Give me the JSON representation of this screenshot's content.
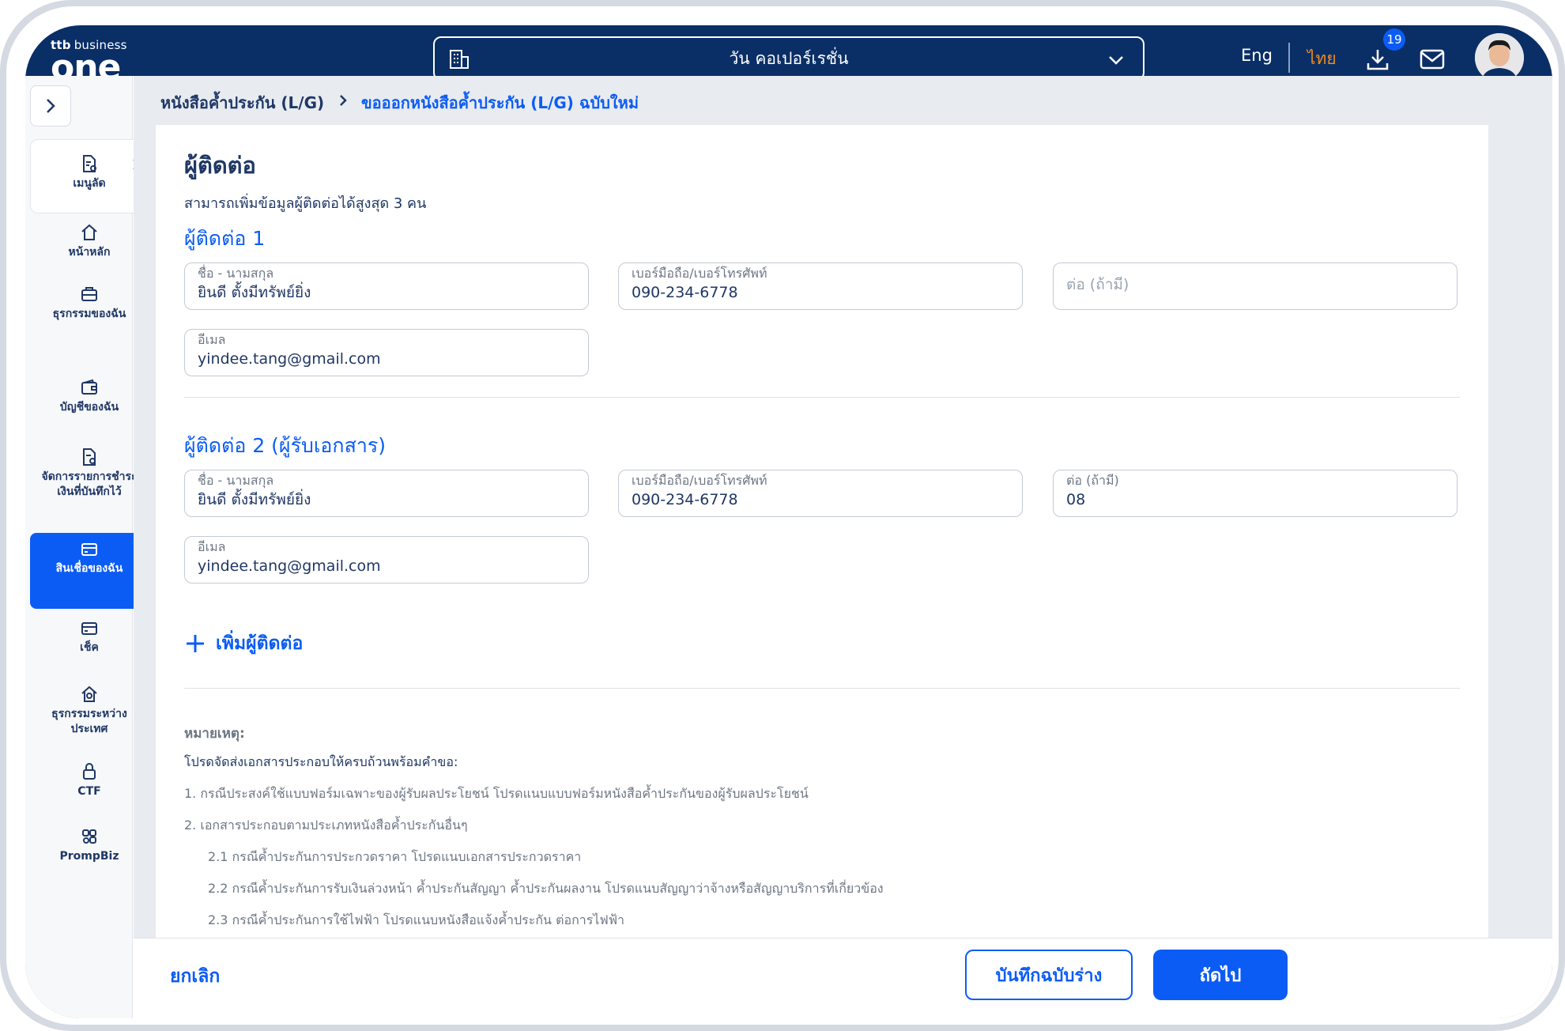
{
  "header": {
    "logo_top_brand": "ttb",
    "logo_top_text": "business",
    "logo_main": "one",
    "company_name": "วัน คอเปอร์เรชั่น",
    "lang_en": "Eng",
    "lang_th": "ไทย",
    "download_badge": "19"
  },
  "sidebar": {
    "items": [
      {
        "label": "เมนูลัด",
        "icon": "doc-shortcut-icon"
      },
      {
        "label": "หน้าหลัก",
        "icon": "home-icon"
      },
      {
        "label": "ธุรกรรมของฉัน",
        "icon": "briefcase-icon"
      },
      {
        "label": "บัญชีของฉัน",
        "icon": "wallet-icon"
      },
      {
        "label": "จัดการรายการชำระเงินที่บันทึกไว้",
        "icon": "doc-settings-icon"
      },
      {
        "label": "สินเชื่อของฉัน",
        "icon": "credit-card-icon"
      },
      {
        "label": "เช็ค",
        "icon": "cheque-icon"
      },
      {
        "label": "ธุรกรรมระหว่างประเทศ",
        "icon": "international-icon"
      },
      {
        "label": "CTF",
        "icon": "lock-icon"
      },
      {
        "label": "PrompBiz",
        "icon": "prompbiz-icon"
      }
    ]
  },
  "breadcrumb": {
    "parent": "หนังสือค้ำประกัน (L/G)",
    "current": "ขอออกหนังสือค้ำประกัน (L/G) ฉบับใหม่"
  },
  "section": {
    "title": "ผู้ติดต่อ",
    "subtitle": "สามารถเพิ่มข้อมูลผู้ติดต่อได้สูงสุด 3 คน"
  },
  "contact1": {
    "title": "ผู้ติดต่อ 1",
    "name_label": "ชื่อ - นามสกุล",
    "name_value": "ยินดี ตั้งมีทรัพย์ยิ่ง",
    "phone_label": "เบอร์มือถือ/เบอร์โทรศัพท์",
    "phone_value": "090-234-6778",
    "ext_placeholder": "ต่อ (ถ้ามี)",
    "email_label": "อีเมล",
    "email_value": "yindee.tang@gmail.com"
  },
  "contact2": {
    "title": "ผู้ติดต่อ 2 (ผู้รับเอกสาร)",
    "name_label": "ชื่อ - นามสกุล",
    "name_value": "ยินดี ตั้งมีทรัพย์ยิ่ง",
    "phone_label": "เบอร์มือถือ/เบอร์โทรศัพท์",
    "phone_value": "090-234-6778",
    "ext_label": "ต่อ (ถ้ามี)",
    "ext_value": "08",
    "email_label": "อีเมล",
    "email_value": "yindee.tang@gmail.com"
  },
  "add_contact_label": "เพิ่มผู้ติดต่อ",
  "notes": {
    "title": "หมายเหตุ:",
    "intro": "โปรดจัดส่งเอกสารประกอบให้ครบถ้วนพร้อมคำขอ:",
    "items": [
      "1.   กรณีประสงค์ใช้แบบฟอร์มเฉพาะของผู้รับผลประโยชน์ โปรดแนบแบบฟอร์มหนังสือค้ำประกันของผู้รับผลประโยชน์",
      "2.   เอกสารประกอบตามประเภทหนังสือค้ำประกันอื่นๆ",
      "2.1  กรณีค้ำประกันการประกวดราคา โปรดแนบเอกสารประกวดราคา",
      "2.2  กรณีค้ำประกันการรับเงินล่วงหน้า ค้ำประกันสัญญา ค้ำประกันผลงาน โปรดแนบสัญญาว่าจ้างหรือสัญญาบริการที่เกี่ยวข้อง",
      "2.3  กรณีค้ำประกันการใช้ไฟฟ้า โปรดแนบหนังสือแจ้งค้ำประกัน ต่อการไฟฟ้า"
    ]
  },
  "footer": {
    "cancel": "ยกเลิก",
    "save_draft": "บันทึกฉบับร่าง",
    "next": "ถัดไป"
  },
  "colors": {
    "brand_navy": "#0a2f66",
    "accent_blue": "#0b5cf5",
    "lang_active": "#f08a1c"
  }
}
